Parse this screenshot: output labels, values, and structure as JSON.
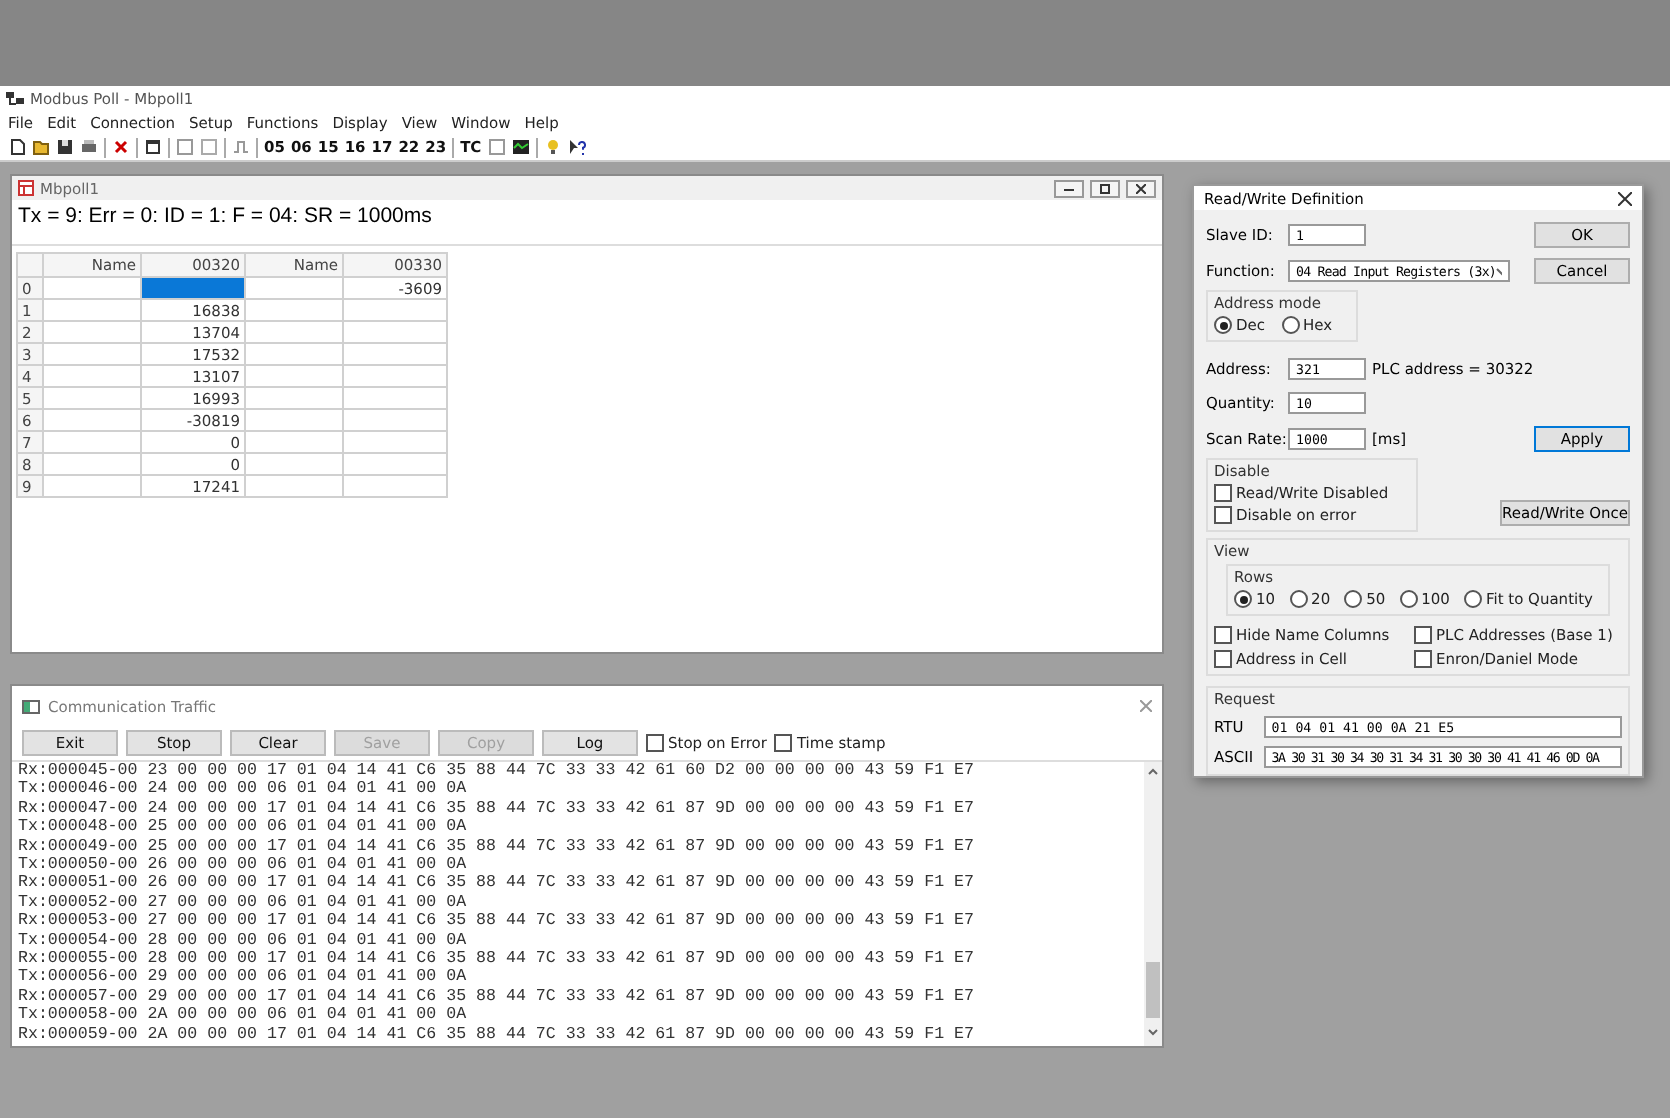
{
  "app": {
    "title": "Modbus Poll - Mbpoll1",
    "menu": [
      "File",
      "Edit",
      "Connection",
      "Setup",
      "Functions",
      "Display",
      "View",
      "Window",
      "Help"
    ],
    "toolbar": {
      "function_codes": [
        "05",
        "06",
        "15",
        "16",
        "17",
        "22",
        "23"
      ],
      "tc": "TC"
    }
  },
  "poll_window": {
    "title": "Mbpoll1",
    "status": "Tx = 9: Err = 0: ID = 1: F = 04: SR = 1000ms",
    "columns": [
      "Name",
      "00320",
      "Name",
      "00330"
    ],
    "rows": [
      {
        "label": "0",
        "cells": [
          {
            "selected": false
          },
          {
            "selected": true
          },
          {
            "selected": false
          },
          {
            "text": "-3609",
            "selected": false
          }
        ]
      },
      {
        "label": "1",
        "cells": [
          {
            "selected": false
          },
          {
            "text": "16838",
            "selected": false
          },
          {
            "selected": false
          },
          {
            "selected": false
          }
        ]
      },
      {
        "label": "2",
        "cells": [
          {
            "selected": false
          },
          {
            "text": "13704",
            "selected": false
          },
          {
            "selected": false
          },
          {
            "selected": false
          }
        ]
      },
      {
        "label": "3",
        "cells": [
          {
            "selected": false
          },
          {
            "text": "17532",
            "selected": false
          },
          {
            "selected": false
          },
          {
            "selected": false
          }
        ]
      },
      {
        "label": "4",
        "cells": [
          {
            "selected": false
          },
          {
            "text": "13107",
            "selected": false
          },
          {
            "selected": false
          },
          {
            "selected": false
          }
        ]
      },
      {
        "label": "5",
        "cells": [
          {
            "selected": false
          },
          {
            "text": "16993",
            "selected": false
          },
          {
            "selected": false
          },
          {
            "selected": false
          }
        ]
      },
      {
        "label": "6",
        "cells": [
          {
            "selected": false
          },
          {
            "text": "-30819",
            "selected": false
          },
          {
            "selected": false
          },
          {
            "selected": false
          }
        ]
      },
      {
        "label": "7",
        "cells": [
          {
            "selected": false
          },
          {
            "text": "0",
            "selected": false
          },
          {
            "selected": false
          },
          {
            "selected": false
          }
        ]
      },
      {
        "label": "8",
        "cells": [
          {
            "selected": false
          },
          {
            "text": "0",
            "selected": false
          },
          {
            "selected": false
          },
          {
            "selected": false
          }
        ]
      },
      {
        "label": "9",
        "cells": [
          {
            "selected": false
          },
          {
            "text": "17241",
            "selected": false
          },
          {
            "selected": false
          },
          {
            "selected": false
          }
        ]
      }
    ]
  },
  "traffic": {
    "title": "Communication Traffic",
    "buttons": [
      {
        "label": "Exit",
        "disabled": false
      },
      {
        "label": "Stop",
        "disabled": false
      },
      {
        "label": "Clear",
        "disabled": false
      },
      {
        "label": "Save",
        "disabled": true
      },
      {
        "label": "Copy",
        "disabled": true
      },
      {
        "label": "Log",
        "disabled": false
      }
    ],
    "options": [
      {
        "label": "Stop on Error",
        "checked": false
      },
      {
        "label": "Time stamp",
        "checked": false
      }
    ],
    "lines": [
      "Rx:000045-00 23 00 00 00 17 01 04 14 41 C6 35 88 44 7C 33 33 42 61 60 D2 00 00 00 00 43 59 F1 E7",
      "Tx:000046-00 24 00 00 00 06 01 04 01 41 00 0A",
      "Rx:000047-00 24 00 00 00 17 01 04 14 41 C6 35 88 44 7C 33 33 42 61 87 9D 00 00 00 00 43 59 F1 E7",
      "Tx:000048-00 25 00 00 00 06 01 04 01 41 00 0A",
      "Rx:000049-00 25 00 00 00 17 01 04 14 41 C6 35 88 44 7C 33 33 42 61 87 9D 00 00 00 00 43 59 F1 E7",
      "Tx:000050-00 26 00 00 00 06 01 04 01 41 00 0A",
      "Rx:000051-00 26 00 00 00 17 01 04 14 41 C6 35 88 44 7C 33 33 42 61 87 9D 00 00 00 00 43 59 F1 E7",
      "Tx:000052-00 27 00 00 00 06 01 04 01 41 00 0A",
      "Rx:000053-00 27 00 00 00 17 01 04 14 41 C6 35 88 44 7C 33 33 42 61 87 9D 00 00 00 00 43 59 F1 E7",
      "Tx:000054-00 28 00 00 00 06 01 04 01 41 00 0A",
      "Rx:000055-00 28 00 00 00 17 01 04 14 41 C6 35 88 44 7C 33 33 42 61 87 9D 00 00 00 00 43 59 F1 E7",
      "Tx:000056-00 29 00 00 00 06 01 04 01 41 00 0A",
      "Rx:000057-00 29 00 00 00 17 01 04 14 41 C6 35 88 44 7C 33 33 42 61 87 9D 00 00 00 00 43 59 F1 E7",
      "Tx:000058-00 2A 00 00 00 06 01 04 01 41 00 0A",
      "Rx:000059-00 2A 00 00 00 17 01 04 14 41 C6 35 88 44 7C 33 33 42 61 87 9D 00 00 00 00 43 59 F1 E7"
    ]
  },
  "dialog": {
    "title": "Read/Write Definition",
    "slave_id": {
      "label": "Slave ID:",
      "value": "1"
    },
    "function": {
      "label": "Function:",
      "value": "04 Read Input Registers (3x)"
    },
    "address_mode": {
      "label": "Address mode",
      "options": [
        {
          "label": "Dec",
          "selected": true
        },
        {
          "label": "Hex",
          "selected": false
        }
      ]
    },
    "address": {
      "label": "Address:",
      "value": "321",
      "note": "PLC address = 30322"
    },
    "quantity": {
      "label": "Quantity:",
      "value": "10"
    },
    "scan_rate": {
      "label": "Scan Rate:",
      "value": "1000",
      "unit": "[ms]"
    },
    "disable": {
      "label": "Disable",
      "options": [
        {
          "label": "Read/Write Disabled",
          "checked": false
        },
        {
          "label": "Disable on error",
          "checked": false
        }
      ]
    },
    "view": {
      "label": "View",
      "rows_label": "Rows",
      "rows": [
        {
          "label": "10",
          "selected": true
        },
        {
          "label": "20",
          "selected": false
        },
        {
          "label": "50",
          "selected": false
        },
        {
          "label": "100",
          "selected": false
        },
        {
          "label": "Fit to Quantity",
          "selected": false
        }
      ],
      "options": [
        {
          "label": "Hide Name Columns",
          "checked": false
        },
        {
          "label": "PLC Addresses (Base 1)",
          "checked": false
        },
        {
          "label": "Address in Cell",
          "checked": false
        },
        {
          "label": "Enron/Daniel Mode",
          "checked": false
        }
      ]
    },
    "request": {
      "label": "Request",
      "rtu": {
        "label": "RTU",
        "value": "01 04 01 41 00 0A 21 E5"
      },
      "ascii": {
        "label": "ASCII",
        "value": "3A 30 31 30 34 30 31 34 31 30 30 30 41 41 46 0D 0A"
      }
    },
    "buttons": {
      "ok": "OK",
      "cancel": "Cancel",
      "apply": "Apply",
      "once": "Read/Write Once"
    }
  }
}
